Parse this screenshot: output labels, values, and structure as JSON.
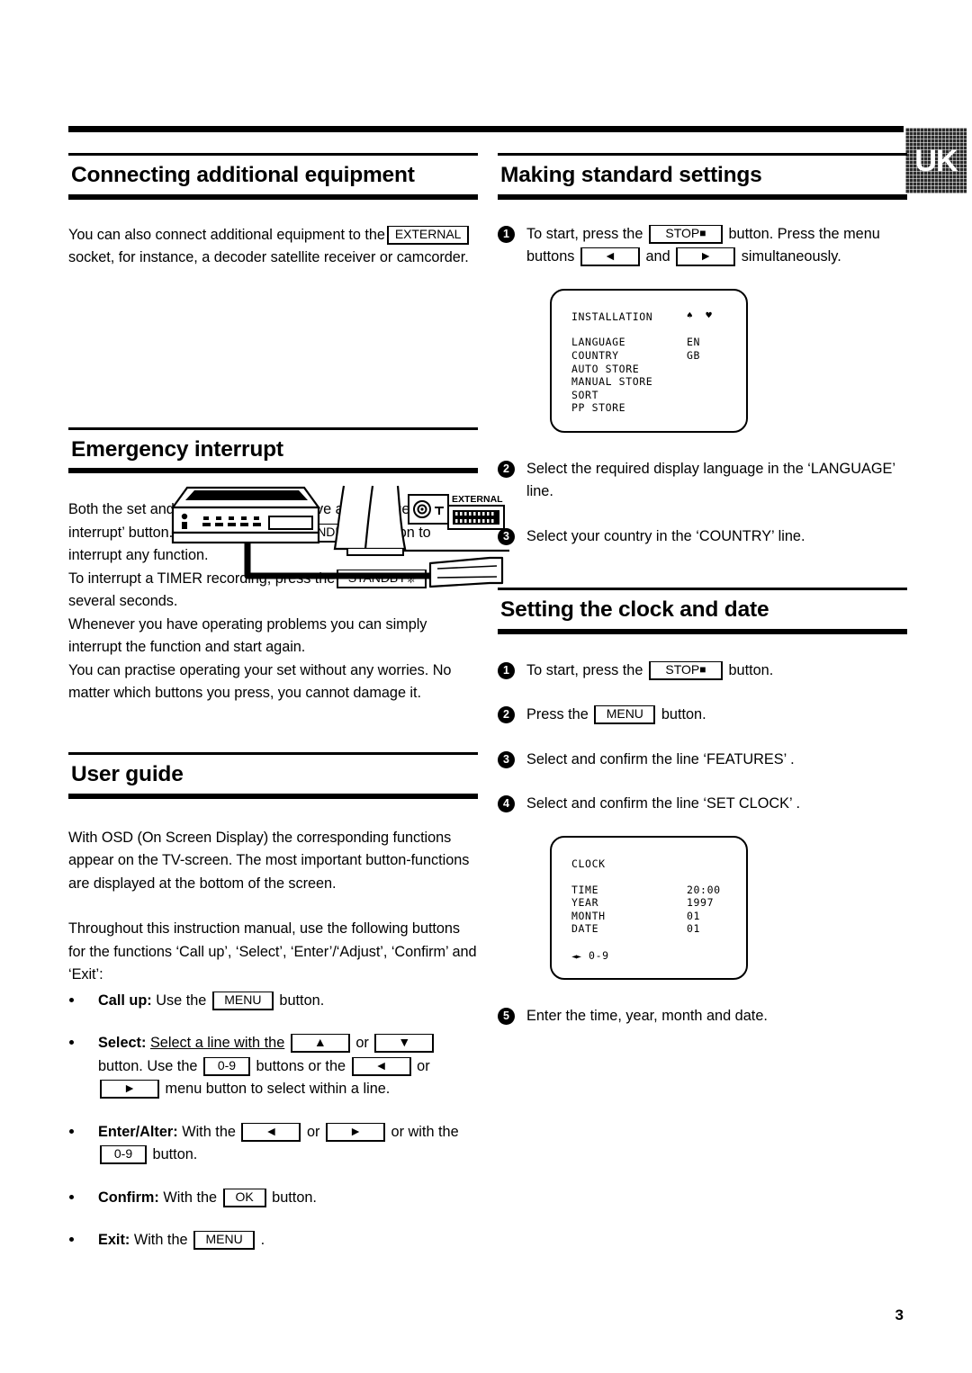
{
  "page": {
    "language_tab": "UK",
    "page_number": "3"
  },
  "left_column": {
    "section1": {
      "heading": "Connecting additional equipment",
      "paragraph_before_key": "You can also connect additional equipment to the",
      "key_external": "EXTERNAL",
      "paragraph_after_key": "socket, for instance, a decoder satellite receiver or camcorder.",
      "diagram": {
        "external_socket_label": "EXTERNAL",
        "device": "vcr-recorder",
        "tv": "television-side-panel",
        "cable": "scart-cable"
      }
    },
    "section2": {
      "heading": "Emergency interrupt",
      "line1_a": "Both the set and the remote control have an ‘Emergency interrupt’ button. You can use the",
      "key_standby": "STANDBY",
      "line1_b": "button to interrupt any function.",
      "line2_a": "To interrupt a TIMER recording, press the",
      "line2_b": "button several seconds.",
      "line3": "Whenever you have operating problems you can simply interrupt the function and start again.",
      "line4": "You can practise operating your set without any worries. No matter which buttons you press, you cannot damage it."
    },
    "section3": {
      "heading": "User guide",
      "paragraph1": "With OSD (On Screen Display) the corresponding functions appear on the TV-screen. The most important button-functions are displayed at the bottom of the screen.",
      "paragraph2": "Throughout this instruction manual, use the following buttons for the functions ‘Call up’, ‘Select’, ‘Enter’/‘Adjust’, ‘Confirm’ and ‘Exit’:",
      "bullets": [
        {
          "label": "Call up:",
          "text_a": "Use the",
          "key1": "MENU",
          "text_b": "button."
        },
        {
          "label": "Select:",
          "text_a": "Select a line with the",
          "key_up": "▲",
          "text_or": "or",
          "key_down": "▼",
          "text_b": "button. Use the",
          "key_num": "0-9",
          "text_c": "buttons or the",
          "key_left": "◄",
          "key_right": "►",
          "text_d": "menu button to select within a line."
        },
        {
          "label": "Enter/Alter:",
          "text_a": "With the",
          "key_left": "◄",
          "text_or": "or",
          "key_right": "►",
          "text_b": "or with the",
          "key_num": "0-9",
          "text_c": "button."
        },
        {
          "label": "Confirm:",
          "text_a": "With the",
          "key_ok": "OK",
          "text_b": "button."
        },
        {
          "label": "Exit:",
          "text_a": "With the",
          "key_menu": "MENU",
          "text_b": "."
        }
      ]
    }
  },
  "right_column": {
    "section1": {
      "heading": "Making standard settings",
      "steps": [
        {
          "num": "1",
          "text_a": "To start, press the",
          "key_stop": "STOP",
          "text_b": "button. Press the menu buttons",
          "key_left": "◄",
          "text_and": "and",
          "key_right": "►",
          "text_c": "simultaneously."
        },
        {
          "num": "2",
          "text": "Select the required display language in the ‘LANGUAGE’ line."
        },
        {
          "num": "3",
          "text": "Select your country in the ‘COUNTRY’ line."
        }
      ],
      "osd_installation": {
        "title": "INSTALLATION",
        "arrows": "♠ ♥",
        "rows": [
          {
            "label": "LANGUAGE",
            "value": "EN"
          },
          {
            "label": "COUNTRY",
            "value": "GB"
          },
          {
            "label": "AUTO STORE",
            "value": ""
          },
          {
            "label": "MANUAL STORE",
            "value": ""
          },
          {
            "label": "SORT",
            "value": ""
          },
          {
            "label": "PP STORE",
            "value": ""
          }
        ]
      }
    },
    "section2": {
      "heading": "Setting the clock and date",
      "steps": [
        {
          "num": "1",
          "text_a": "To start, press the",
          "key_stop": "STOP",
          "text_b": "button."
        },
        {
          "num": "2",
          "text_a": "Press the",
          "key_menu": "MENU",
          "text_b": "button."
        },
        {
          "num": "3",
          "text": "Select and confirm the line ‘FEATURES’ ."
        },
        {
          "num": "4",
          "text": "Select and confirm the line ‘SET CLOCK’ ."
        }
      ],
      "osd_clock": {
        "title": "CLOCK",
        "rows": [
          {
            "label": "TIME",
            "value": "20:00"
          },
          {
            "label": "YEAR",
            "value": "1997"
          },
          {
            "label": "MONTH",
            "value": "01"
          },
          {
            "label": "DATE",
            "value": "01"
          }
        ],
        "footer_arrows": "◄►",
        "footer_text": "0-9"
      },
      "step5": {
        "num": "5",
        "text": "Enter the time, year, month and date."
      }
    }
  }
}
